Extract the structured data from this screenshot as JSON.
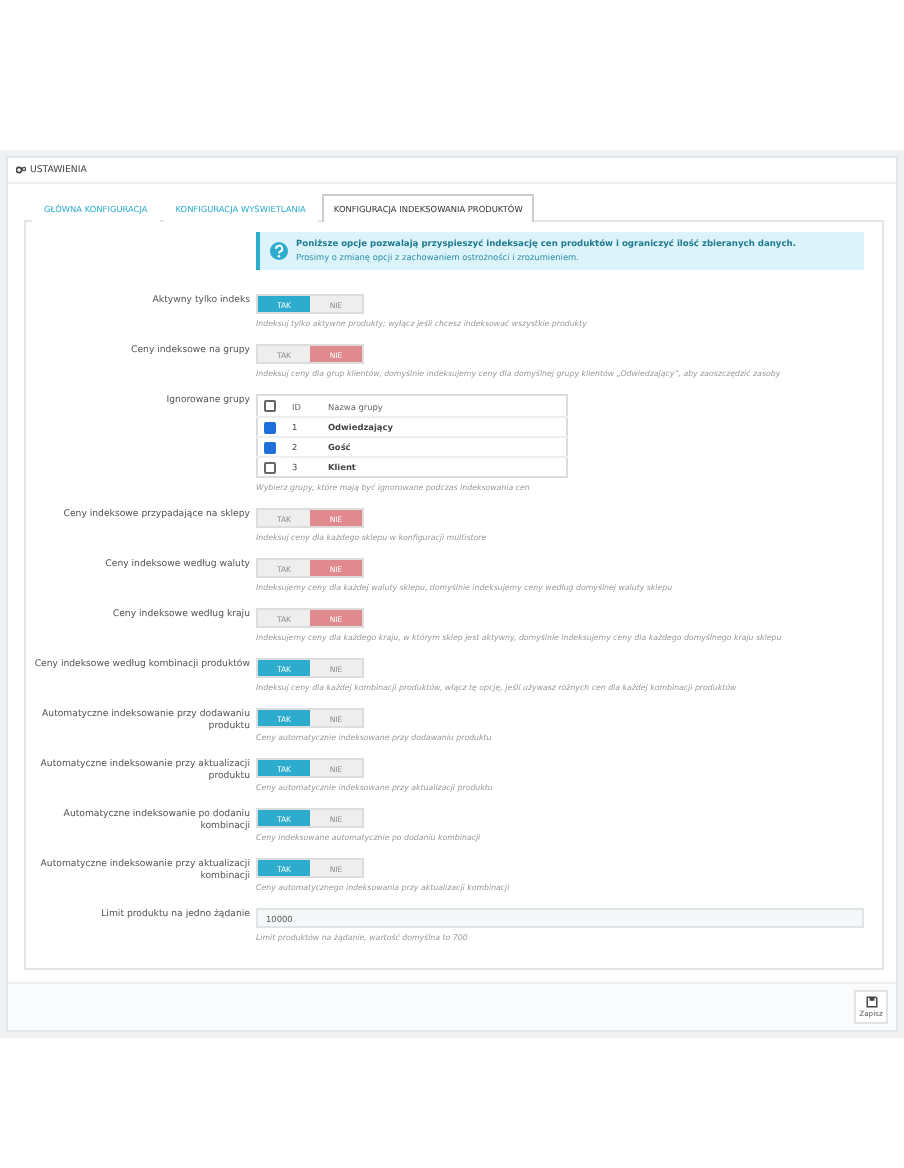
{
  "panel": {
    "title": "USTAWIENIA"
  },
  "tabs": [
    {
      "label": "GŁÓWNA KONFIGURACJA",
      "selected": false
    },
    {
      "label": "KONFIGURACJA WYŚWIETLANIA",
      "selected": false
    },
    {
      "label": "KONFIGURACJA INDEKSOWANIA PRODUKTÓW",
      "selected": true
    }
  ],
  "info": {
    "title": "Poniższe opcje pozwalają przyspieszyć indeksację cen produktów i ograniczyć ilość zbieranych danych.",
    "text": "Prosimy o zmianę opcji z zachowaniem ostrożności i zrozumieniem."
  },
  "fields": [
    {
      "kind": "switch",
      "label": "Aktywny tylko indeks",
      "yes": "TAK",
      "no": "NIE",
      "on": true,
      "help": "Indeksuj tylko aktywne produkty; wyłącz jeśli chcesz indeksować wszystkie produkty"
    },
    {
      "kind": "switch",
      "label": "Ceny indeksowe na grupy",
      "yes": "TAK",
      "no": "NIE",
      "on": false,
      "help": "Indeksuj ceny dla grup klientów, domyślnie indeksujemy ceny dla domyślnej grupy klientów „Odwiedzający”, aby zaoszczędzić zasoby"
    },
    {
      "kind": "groups",
      "label": "Ignorowane grupy",
      "columns": [
        "ID",
        "Nazwa grupy"
      ],
      "all_checked": false,
      "rows": [
        {
          "id": "1",
          "name": "Odwiedzający",
          "checked": true
        },
        {
          "id": "2",
          "name": "Gość",
          "checked": true
        },
        {
          "id": "3",
          "name": "Klient",
          "checked": false
        }
      ],
      "help": "Wybierz grupy, które mają być ignorowane podczas indeksowania cen"
    },
    {
      "kind": "switch",
      "label": "Ceny indeksowe przypadające na sklepy",
      "yes": "TAK",
      "no": "NIE",
      "on": false,
      "help": "Indeksuj ceny dla każdego sklepu w konfiguracji multistore"
    },
    {
      "kind": "switch",
      "label": "Ceny indeksowe według waluty",
      "yes": "TAK",
      "no": "NIE",
      "on": false,
      "help": "Indeksujemy ceny dla każdej waluty sklepu, domyślnie indeksujemy ceny według domyślnej waluty sklepu"
    },
    {
      "kind": "switch",
      "label": "Ceny indeksowe według kraju",
      "yes": "TAK",
      "no": "NIE",
      "on": false,
      "help": "Indeksujemy ceny dla każdego kraju, w którym sklep jest aktywny, domyślnie indeksujemy ceny dla każdego domyślnego kraju sklepu"
    },
    {
      "kind": "switch",
      "label": "Ceny indeksowe według kombinacji produktów",
      "yes": "TAK",
      "no": "NIE",
      "on": true,
      "help": "Indeksuj ceny dla każdej kombinacji produktów, włącz tę opcję, jeśli używasz różnych cen dla każdej kombinacji produktów"
    },
    {
      "kind": "switch",
      "label": "Automatyczne indeksowanie przy dodawaniu produktu",
      "yes": "TAK",
      "no": "NIE",
      "on": true,
      "help": "Ceny automatycznie indeksowane przy dodawaniu produktu"
    },
    {
      "kind": "switch",
      "label": "Automatyczne indeksowanie przy aktualizacji produktu",
      "yes": "TAK",
      "no": "NIE",
      "on": true,
      "help": "Ceny automatycznie indeksowane przy aktualizacji produktu"
    },
    {
      "kind": "switch",
      "label": "Automatyczne indeksowanie po dodaniu kombinacji",
      "yes": "TAK",
      "no": "NIE",
      "on": true,
      "help": "Ceny indeksowane automatycznie po dodaniu kombinacji"
    },
    {
      "kind": "switch",
      "label": "Automatyczne indeksowanie przy aktualizacji kombinacji",
      "yes": "TAK",
      "no": "NIE",
      "on": true,
      "help": "Ceny automatycznego indeksowania przy aktualizacji kombinacji"
    },
    {
      "kind": "text",
      "label": "Limit produktu na jedno żądanie",
      "value": "10000",
      "help": "Limit produktów na żądanie, wartość domyślna to 700"
    }
  ],
  "save_button": {
    "label": "Zapisz"
  }
}
